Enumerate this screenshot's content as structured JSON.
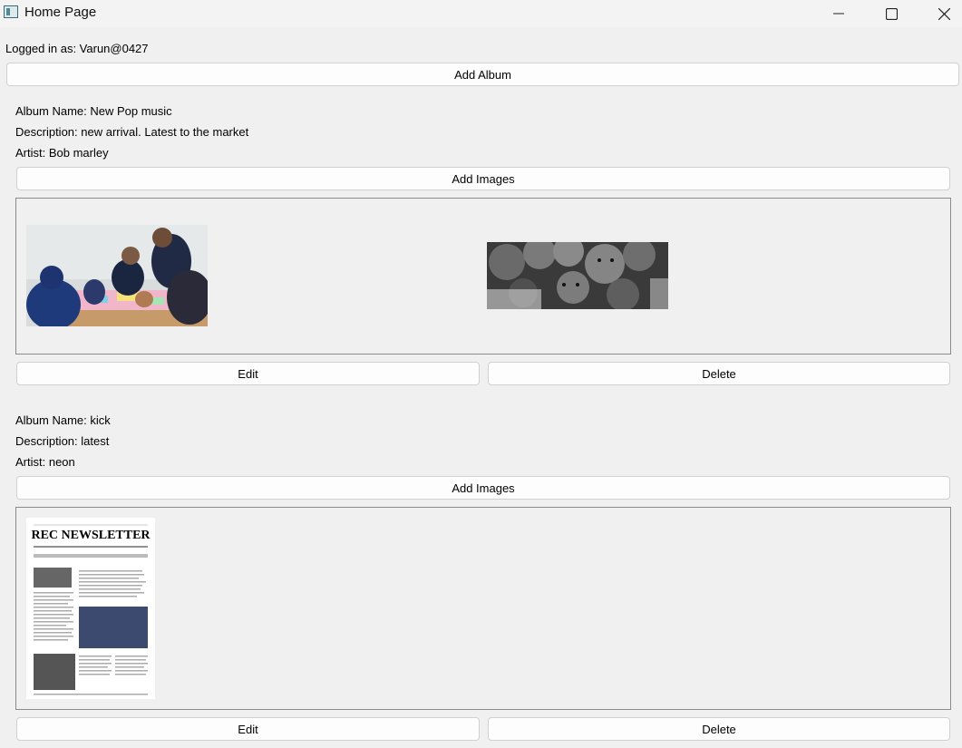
{
  "window": {
    "title": "Home Page",
    "controls": [
      "minimize",
      "maximize",
      "close"
    ]
  },
  "header": {
    "logged_in_label": "Logged in as: Varun@0427",
    "add_album_label": "Add Album"
  },
  "albums": [
    {
      "name": "Album Name: New Pop music",
      "description": "Description: new arrival. Latest to the market",
      "artist": "Artist: Bob marley",
      "add_images_label": "Add Images",
      "edit_label": "Edit",
      "delete_label": "Delete",
      "images": [
        "photo-group-workshop",
        "photo-children-bw"
      ]
    },
    {
      "name": "Album Name: kick",
      "description": "Description: latest",
      "artist": "Artist: neon",
      "add_images_label": "Add Images",
      "edit_label": "Edit",
      "delete_label": "Delete",
      "images": [
        "newsletter-page"
      ],
      "newsletter_heading": "REC NEWSLETTER"
    }
  ],
  "colors": {
    "window_bg": "#f0f0f0",
    "button_bg": "#fdfdfd",
    "button_border": "#d0d0d0",
    "frame_border": "#8a8a8a"
  }
}
